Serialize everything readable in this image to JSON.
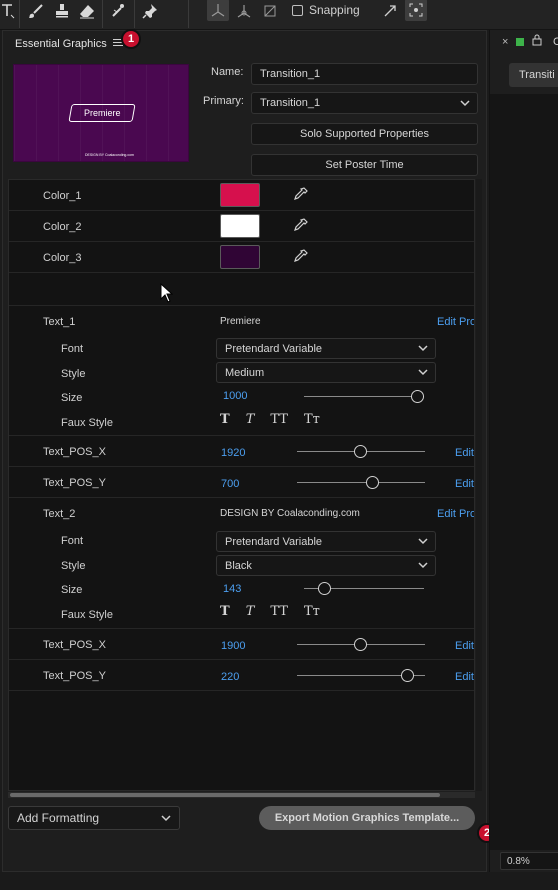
{
  "toolbar": {
    "tools": [
      "type-tool-icon",
      "brush-icon",
      "stamp-icon",
      "eraser-icon",
      "puppet-pin-icon",
      "pin-icon"
    ],
    "snapping_label": "Snapping"
  },
  "panel": {
    "title": "Essential Graphics",
    "badge_1": "1",
    "badge_2": "2",
    "thumbnail": {
      "title_text": "Premiere",
      "small_text": "DESIGN BY Coalaconding.com",
      "background_color": "#4a0850"
    },
    "name_label": "Name:",
    "name_value": "Transition_1",
    "primary_label": "Primary:",
    "primary_value": "Transition_1",
    "solo_button": "Solo Supported Properties",
    "poster_button": "Set Poster Time"
  },
  "properties": {
    "colors": [
      {
        "label": "Color_1",
        "color": "#d6104d"
      },
      {
        "label": "Color_2",
        "color": "#ffffff"
      },
      {
        "label": "Color_3",
        "color": "#300535"
      }
    ],
    "text_1": {
      "label": "Text_1",
      "value": "Premiere",
      "edit": "Edit Prop",
      "font_label": "Font",
      "font_value": "Pretendard Variable",
      "style_label": "Style",
      "style_value": "Medium",
      "size_label": "Size",
      "size_value": "1000",
      "faux_label": "Faux Style",
      "faux_styles": [
        "T",
        "T",
        "TT",
        "Tт"
      ]
    },
    "text_1_pos_x": {
      "label": "Text_POS_X",
      "value": "1920",
      "edit": "Edit"
    },
    "text_1_pos_y": {
      "label": "Text_POS_Y",
      "value": "700",
      "edit": "Edit"
    },
    "text_2": {
      "label": "Text_2",
      "value": "DESIGN BY Coalaconding.com",
      "edit": "Edit Prop",
      "font_label": "Font",
      "font_value": "Pretendard Variable",
      "style_label": "Style",
      "style_value": "Black",
      "size_label": "Size",
      "size_value": "143",
      "faux_label": "Faux Style",
      "faux_styles": [
        "T",
        "T",
        "TT",
        "Tт"
      ]
    },
    "text_2_pos_x": {
      "label": "Text_POS_X",
      "value": "1900",
      "edit": "Edit"
    },
    "text_2_pos_y": {
      "label": "Text_POS_Y",
      "value": "220",
      "edit": "Edit"
    }
  },
  "footer": {
    "add_formatting": "Add Formatting",
    "export_button": "Export Motion Graphics Template..."
  },
  "right_panel": {
    "close": "×",
    "letter": "C",
    "tab_label": "Transiti",
    "zoom": "0.8%"
  }
}
